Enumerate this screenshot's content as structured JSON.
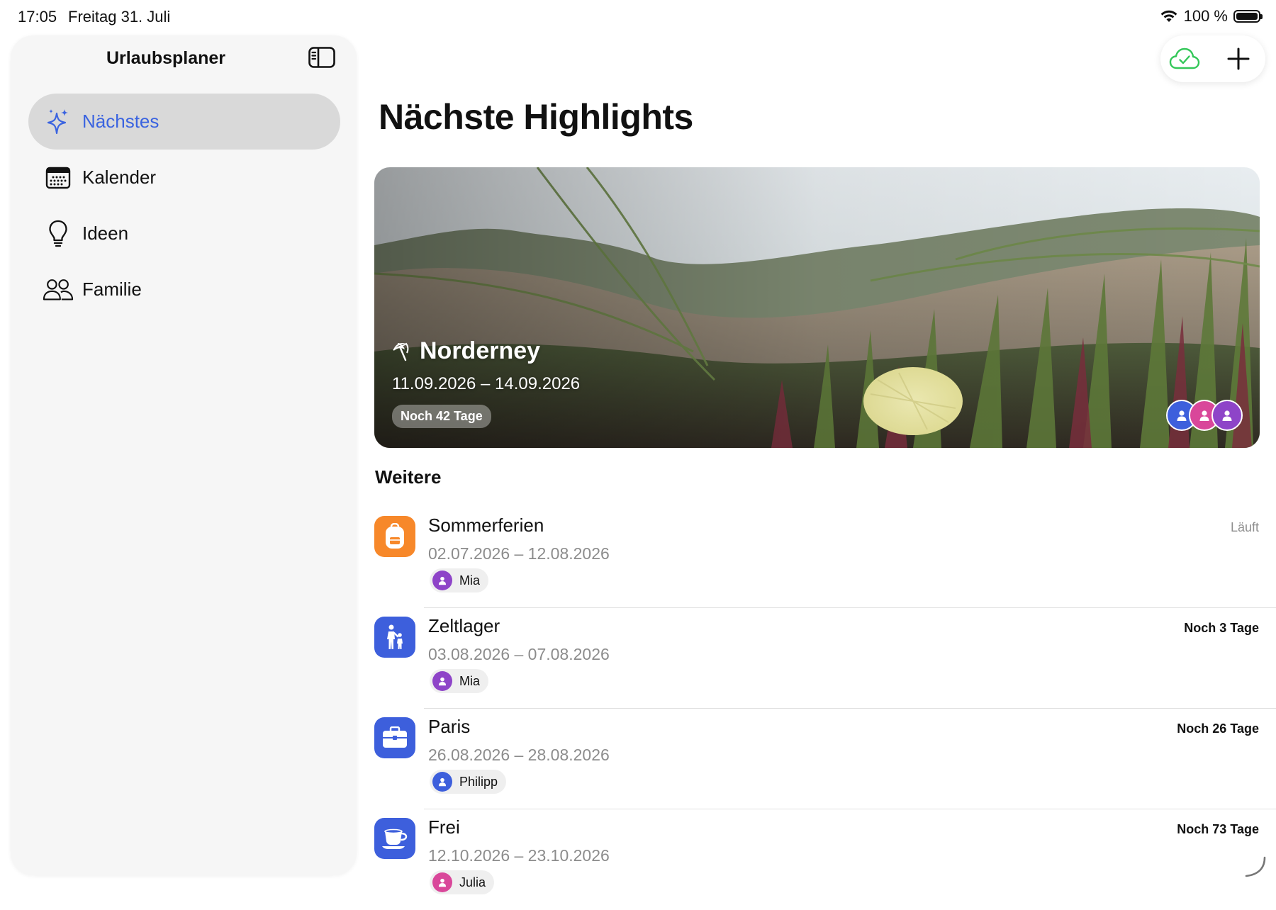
{
  "status_bar": {
    "time": "17:05",
    "date": "Freitag 31. Juli",
    "battery": "100 %"
  },
  "sidebar": {
    "title": "Urlaubsplaner",
    "items": [
      {
        "label": "Nächstes",
        "icon": "sparkles-icon",
        "active": true
      },
      {
        "label": "Kalender",
        "icon": "calendar-icon",
        "active": false
      },
      {
        "label": "Ideen",
        "icon": "lightbulb-icon",
        "active": false
      },
      {
        "label": "Familie",
        "icon": "people-icon",
        "active": false
      }
    ]
  },
  "toolbar": {
    "sync_icon": "cloud-check-icon",
    "add_icon": "plus-icon"
  },
  "main": {
    "title": "Nächste Highlights",
    "hero": {
      "name": "Norderney",
      "icon": "beach-umbrella-icon",
      "dates": "11.09.2026 – 14.09.2026",
      "badge": "Noch 42 Tage"
    },
    "section_title": "Weitere",
    "items": [
      {
        "title": "Sommerferien",
        "dates": "02.07.2026 – 12.08.2026",
        "status": "Läuft",
        "person": "Mia",
        "icon": "backpack-icon",
        "color": "#f7882a"
      },
      {
        "title": "Zeltlager",
        "dates": "03.08.2026 – 07.08.2026",
        "status": "Noch 3 Tage",
        "person": "Mia",
        "icon": "family-walk-icon",
        "color": "#3d5fdc"
      },
      {
        "title": "Paris",
        "dates": "26.08.2026 – 28.08.2026",
        "status": "Noch 26 Tage",
        "person": "Philipp",
        "icon": "briefcase-icon",
        "color": "#3d5fdc"
      },
      {
        "title": "Frei",
        "dates": "12.10.2026 – 23.10.2026",
        "status": "Noch 73 Tage",
        "person": "Julia",
        "icon": "coffee-cup-icon",
        "color": "#3d5fdc"
      }
    ]
  },
  "colors": {
    "accent": "#3a63e0",
    "orange": "#f7882a",
    "blue": "#3d5fdc",
    "purple": "#8e44c8",
    "pink": "#d9479a",
    "green": "#34c759"
  }
}
